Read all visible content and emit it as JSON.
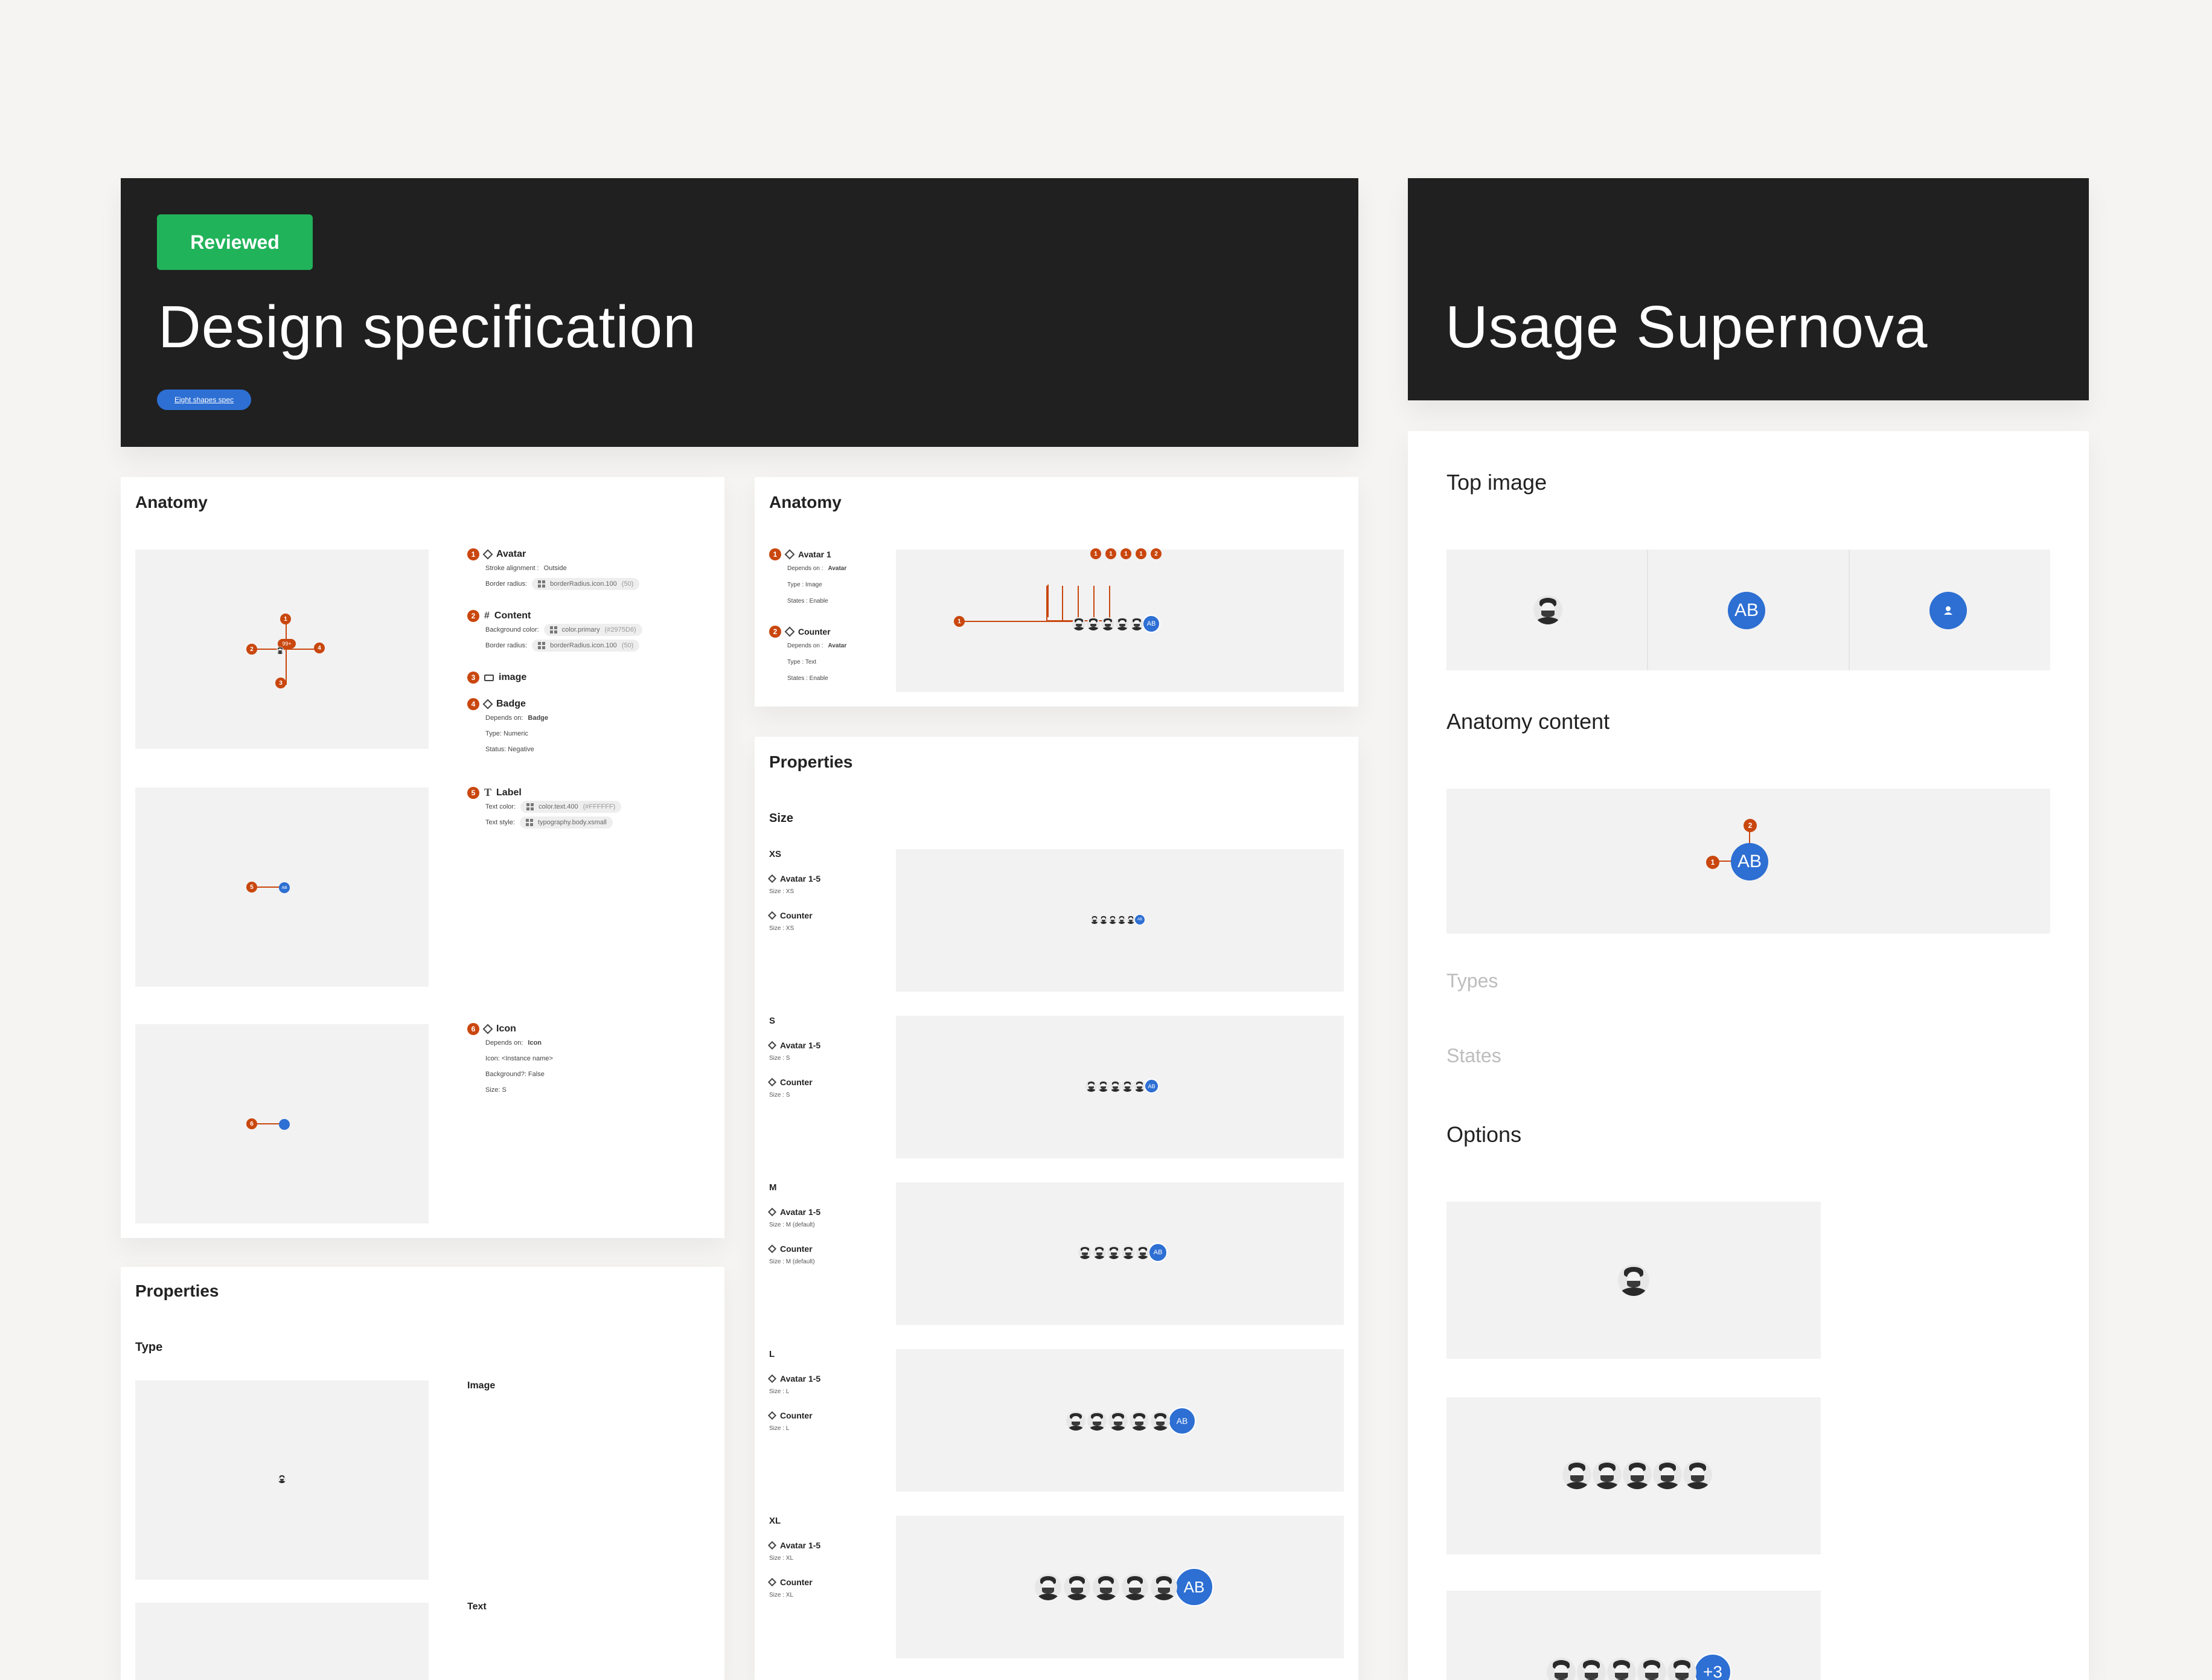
{
  "design_panel": {
    "badge": "Reviewed",
    "title": "Design specification",
    "link": "Eight shapes spec"
  },
  "usage_panel": {
    "title": "Usage Supernova",
    "top_image": "Top image",
    "anatomy_content": "Anatomy content",
    "types": "Types",
    "states": "States",
    "options": "Options",
    "counter_label": "AB",
    "more_label": "+3"
  },
  "col1": {
    "anatomy_title": "Anatomy",
    "badge_text": "99+",
    "items": [
      {
        "num": "1",
        "title": "Avatar",
        "lines": [
          {
            "label": "Stroke alignment :",
            "value": "Outside"
          },
          {
            "label": "Border radius:",
            "token": "borderRadius.icon.100",
            "extra": "(50)"
          }
        ]
      },
      {
        "num": "2",
        "title": "Content",
        "lines": [
          {
            "label": "Background color:",
            "token": "color.primary",
            "extra": "(#2975D6)"
          },
          {
            "label": "Border radius:",
            "token": "borderRadius.icon.100",
            "extra": "(50)"
          }
        ]
      },
      {
        "num": "3",
        "title": "image",
        "lines": []
      },
      {
        "num": "4",
        "title": "Badge",
        "lines": [
          {
            "label": "Depends on:",
            "bold": "Badge"
          },
          {
            "label": "Type: Numeric"
          },
          {
            "label": "Status: Negative"
          }
        ]
      },
      {
        "num": "5",
        "title": "Label",
        "lines": [
          {
            "label": "Text color:",
            "token": "color.text.400",
            "extra": "(#FFFFFF)"
          },
          {
            "label": "Text style:",
            "token": "typography.body.xsmall"
          }
        ]
      },
      {
        "num": "6",
        "title": "Icon",
        "lines": [
          {
            "label": "Depends on:",
            "bold": "Icon"
          },
          {
            "label": "Icon: <Instance name>"
          },
          {
            "label": "Background?: False"
          },
          {
            "label": "Size: S"
          }
        ]
      }
    ],
    "properties_title": "Properties",
    "type_title": "Type",
    "type_image": "Image",
    "type_text": "Text"
  },
  "col2": {
    "anatomy_title": "Anatomy",
    "items": [
      {
        "num": "1",
        "title": "Avatar 1",
        "lines": [
          "Depends on :",
          "Type : Image",
          "States : Enable"
        ],
        "bold": "Avatar"
      },
      {
        "num": "2",
        "title": "Counter",
        "lines": [
          "Depends on :",
          "Type : Text",
          "States : Enable"
        ],
        "bold": "Avatar"
      }
    ],
    "properties_title": "Properties",
    "size_title": "Size",
    "avatar_label": "Avatar 1-5",
    "counter_label": "Counter",
    "ab": "AB",
    "sizes": [
      {
        "name": "XS",
        "size_text": "Size : XS"
      },
      {
        "name": "S",
        "size_text": "Size : S"
      },
      {
        "name": "M",
        "size_text": "Size : M (default)"
      },
      {
        "name": "L",
        "size_text": "Size : L"
      },
      {
        "name": "XL",
        "size_text": "Size : XL"
      }
    ]
  }
}
